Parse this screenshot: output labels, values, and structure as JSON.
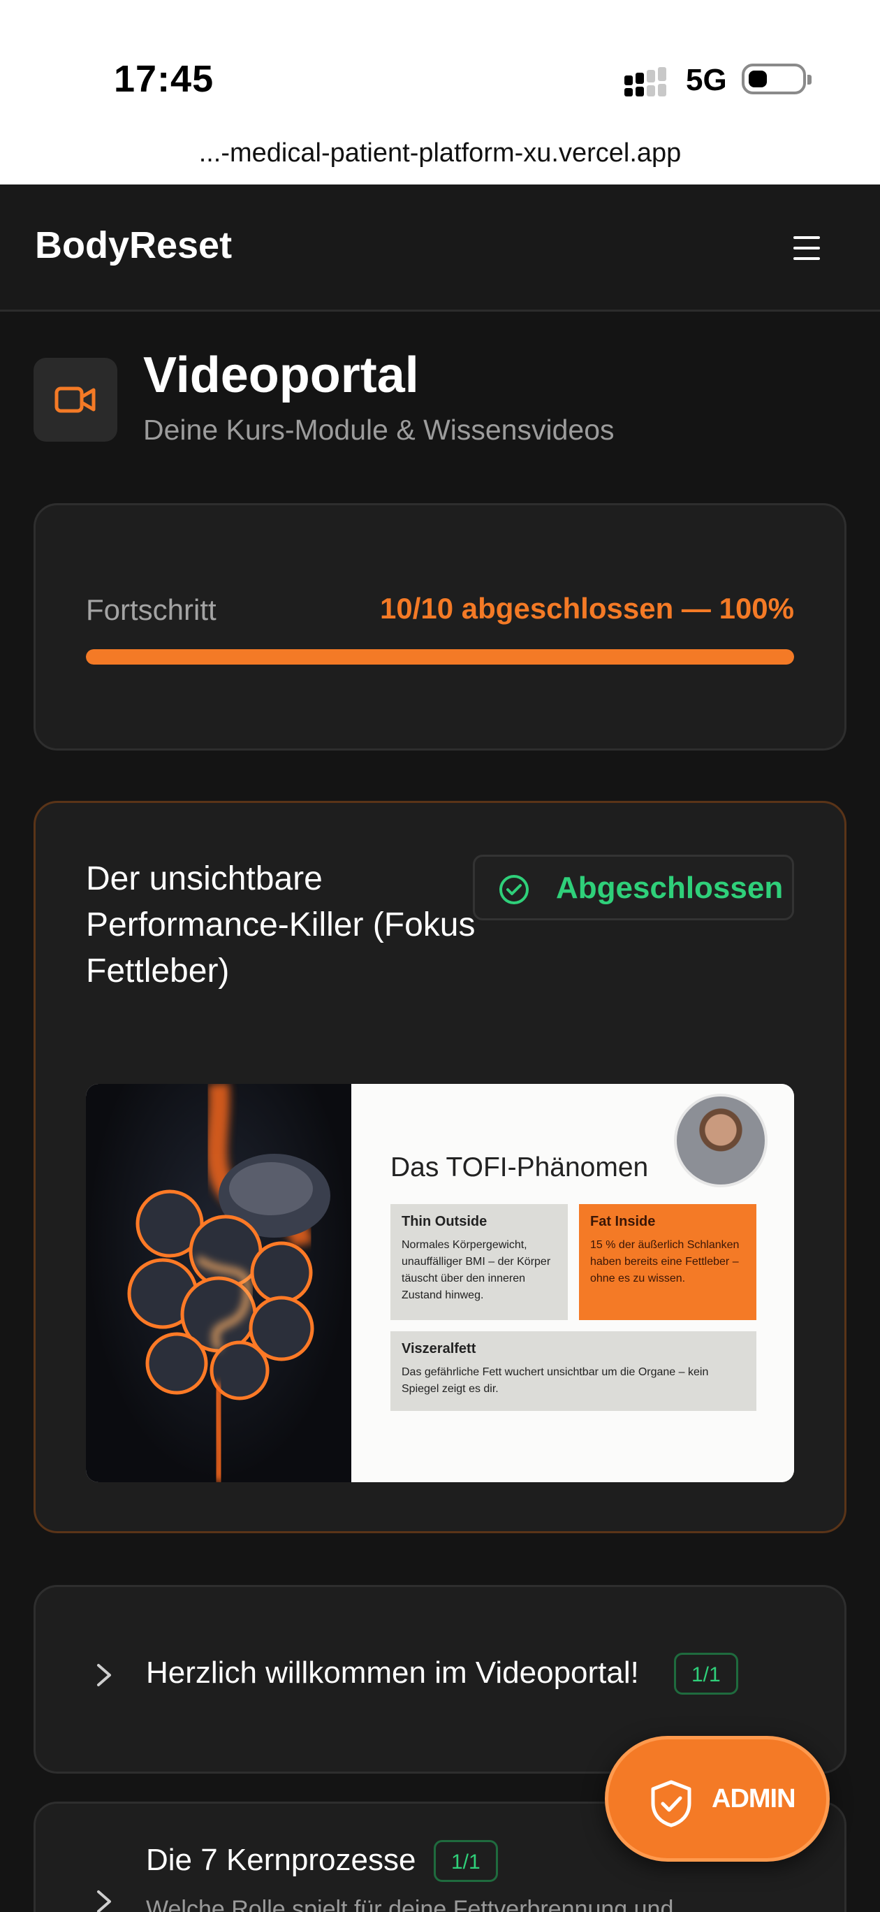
{
  "status_bar": {
    "time": "17:45",
    "network": "5G"
  },
  "browser": {
    "url": "...-medical-patient-platform-xu.vercel.app"
  },
  "header": {
    "brand": "BodyReset"
  },
  "page": {
    "icon": "video-camera-icon",
    "title": "Videoportal",
    "subtitle": "Deine Kurs-Module & Wissensvideos"
  },
  "progress": {
    "label": "Fortschritt",
    "value_text": "10/10 abgeschlossen — 100%",
    "percent": 100
  },
  "featured": {
    "title": "Der unsichtbare Performance-Killer (Fokus Fettleber)",
    "status": "Abgeschlossen",
    "slide": {
      "title": "Das TOFI-Phänomen",
      "boxes": [
        {
          "heading": "Thin Outside",
          "text": "Normales Körpergewicht, unauffälliger BMI – der Körper täuscht über den inneren Zustand hinweg."
        },
        {
          "heading": "Fat Inside",
          "text": "15 % der äußerlich Schlanken haben bereits eine Fettleber – ohne es zu wissen."
        },
        {
          "heading": "Viszeralfett",
          "text": "Das gefährliche Fett wuchert unsichtbar um die Organe – kein Spiegel zeigt es dir."
        }
      ]
    }
  },
  "modules": [
    {
      "title": "Herzlich willkommen im Videoportal!",
      "count": "1/1",
      "description": ""
    },
    {
      "title": "Die 7 Kernprozesse",
      "count": "1/1",
      "description": "Welche Rolle spielt für deine Fettverbrennung und..."
    }
  ],
  "fab": {
    "label": "ADMIN"
  },
  "colors": {
    "accent": "#f47a26",
    "success": "#2fd07a",
    "background": "#141414"
  }
}
